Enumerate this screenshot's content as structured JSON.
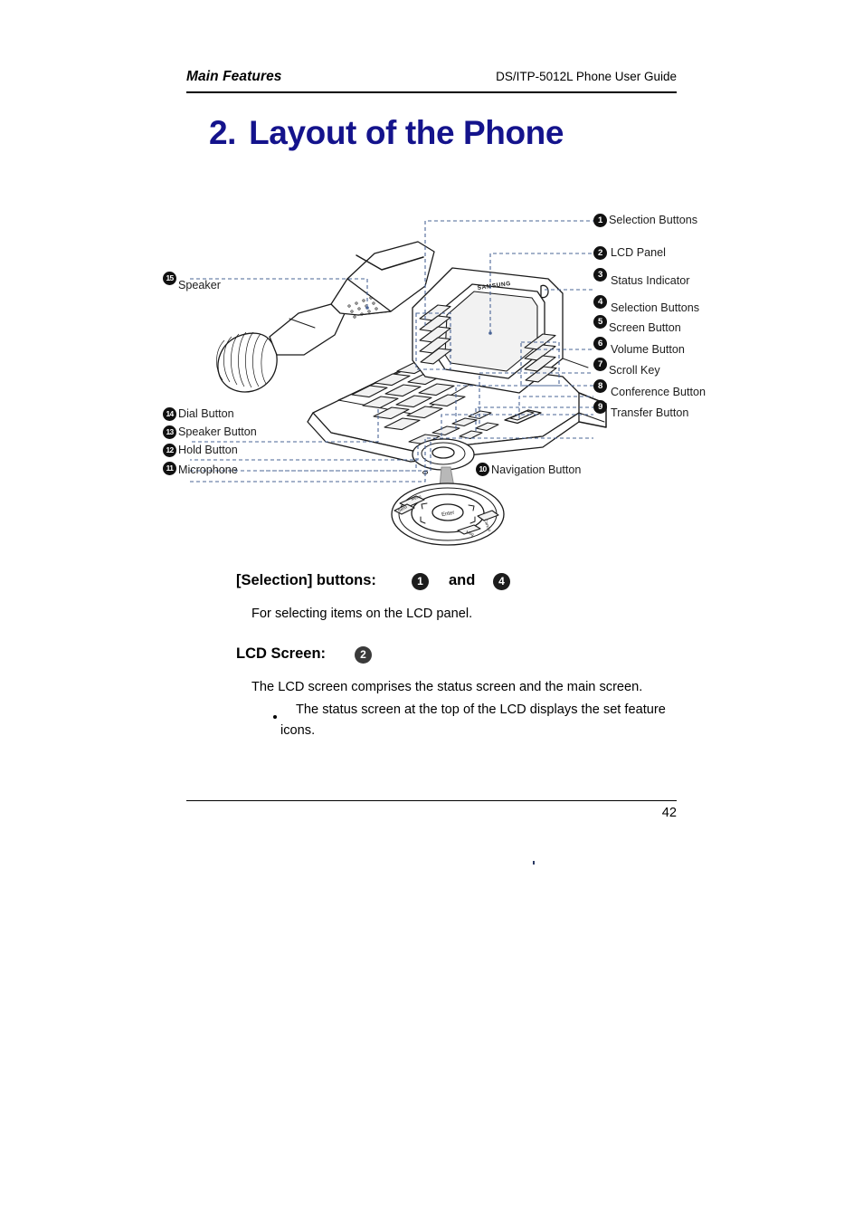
{
  "document": {
    "running_head_left": "Main Features",
    "running_head_right": "DS/ITP-5012L Phone User Guide",
    "chapter_number": "2.",
    "chapter_title": "Layout of the Phone",
    "page_number": "42"
  },
  "figure": {
    "brand_text": "SAMSUNG",
    "callouts_right": [
      {
        "num": "1",
        "label": "Selection Buttons"
      },
      {
        "num": "2",
        "label": "LCD Panel"
      },
      {
        "num": "3",
        "label": "Status Indicator"
      },
      {
        "num": "4",
        "label": "Selection Buttons"
      },
      {
        "num": "5",
        "label": "Screen Button"
      },
      {
        "num": "6",
        "label": "Volume Button"
      },
      {
        "num": "7",
        "label": "Scroll Key"
      },
      {
        "num": "8",
        "label": "Conference Button"
      },
      {
        "num": "9",
        "label": "Transfer Button"
      }
    ],
    "callouts_left": [
      {
        "num": "15",
        "label": "Speaker"
      },
      {
        "num": "14",
        "label": "Dial Button"
      },
      {
        "num": "13",
        "label": "Speaker Button"
      },
      {
        "num": "12",
        "label": "Hold Button"
      },
      {
        "num": "11",
        "label": "Microphone"
      }
    ],
    "callouts_center": [
      {
        "num": "10",
        "label": "Navigation Button"
      }
    ],
    "navigation_detail": {
      "center_key": "Enter",
      "keys": [
        "Menu",
        "Cancel",
        "Hold",
        "Msg",
        "Send"
      ]
    }
  },
  "sections": [
    {
      "heading": "[Selection] buttons:",
      "badges": [
        "1",
        "4"
      ],
      "conjunction": "and",
      "paragraph": "For selecting items on the LCD panel."
    },
    {
      "heading": "LCD Screen:",
      "badges": [
        "2"
      ],
      "paragraph": "The LCD screen comprises the status screen and the main screen.",
      "bullets": [
        "The status screen at the top of the LCD displays the set feature",
        "icons."
      ]
    }
  ],
  "colors": {
    "title_blue": "#14138c",
    "leader_line": "#4a6496",
    "badge_black": "#111111"
  }
}
